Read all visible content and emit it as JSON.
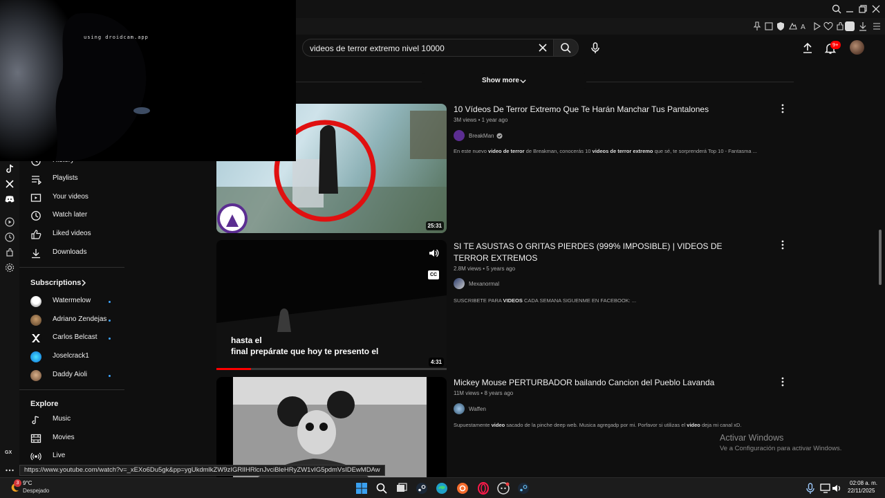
{
  "webcam": {
    "watermark": "using droidcam.app"
  },
  "search": {
    "value": "videos de terror extremo nivel 10000"
  },
  "header": {
    "notification_count": "9+"
  },
  "show_more": {
    "label": "Show more"
  },
  "sidebar": {
    "items": [
      {
        "label": "History",
        "icon": "history-icon"
      },
      {
        "label": "Playlists",
        "icon": "playlists-icon"
      },
      {
        "label": "Your videos",
        "icon": "your-videos-icon"
      },
      {
        "label": "Watch later",
        "icon": "watch-later-icon"
      },
      {
        "label": "Liked videos",
        "icon": "like-icon"
      },
      {
        "label": "Downloads",
        "icon": "download-icon"
      }
    ],
    "subscriptions_header": "Subscriptions",
    "subscriptions": [
      {
        "name": "Watermelow",
        "new": true
      },
      {
        "name": "Adriano Zendejas",
        "new": true
      },
      {
        "name": "Carlos Belcast",
        "new": true
      },
      {
        "name": "Joselcrack1",
        "new": false
      },
      {
        "name": "Daddy Aioli",
        "new": true
      }
    ],
    "explore_header": "Explore",
    "explore": [
      {
        "label": "Music",
        "icon": "music-icon"
      },
      {
        "label": "Movies",
        "icon": "movies-icon"
      },
      {
        "label": "Live",
        "icon": "live-icon"
      }
    ]
  },
  "results": [
    {
      "title": "10 Vídeos De Terror Extremo Que Te Harán Manchar Tus Pantalones",
      "meta": "3M views • 1 year ago",
      "channel": "BreakMan",
      "verified": true,
      "desc_parts": [
        "En este nuevo ",
        "video de terror",
        " de Breakman, conocerás 10 ",
        "videos de terror extremo",
        " que sé, te sorprenderá Top 10 - Fantasma ..."
      ],
      "duration": "25:31"
    },
    {
      "title": "SI TE ASUSTAS O GRITAS PIERDES (999% IMPOSIBLE) | VIDEOS DE TERROR EXTREMOS",
      "meta": "2.8M views • 5 years ago",
      "channel": "Mexanormal",
      "verified": false,
      "desc_parts": [
        "SUSCRIBETE PARA ",
        "VIDEOS",
        " CADA SEMANA SIGUENME EN FACEBOOK: ..."
      ],
      "duration": "4:31",
      "caption_line1": "hasta el",
      "caption_line2": "final prepárate que hoy te presento el",
      "cc_label": "CC",
      "watch_progress": 0.15
    },
    {
      "title": "Mickey Mouse PERTURBADOR bailando Cancion del Pueblo Lavanda",
      "meta": "11M views • 8 years ago",
      "channel": "Waffen",
      "verified": false,
      "desc_parts": [
        "Supuestamente ",
        "video",
        " sacado de la pinche deep web. Musica agregadp por mi. Porfavor si utilizas el ",
        "video",
        " deja mi canal xD."
      ]
    }
  ],
  "status_url": "https://www.youtube.com/watch?v=_xEXo6Du5gk&pp=ygUkdmlkZW9zIGRlIHRlcnJvciBleHRyZW1vIG5pdmVsIDEwMDAw",
  "windows_watermark": {
    "line1": "Activar Windows",
    "line2": "Ve a Configuración para activar Windows."
  },
  "opera_side": {
    "gx_label": "GX"
  },
  "taskbar": {
    "weather_temp": "9°C",
    "weather_desc": "Despejado",
    "weather_badge": "3",
    "time": "02:08 a. m.",
    "date": "22/11/2025"
  },
  "colors": {
    "accent_blue": "#3ea6ff",
    "badge_red": "#ff0000",
    "background": "#0f0f0f"
  }
}
